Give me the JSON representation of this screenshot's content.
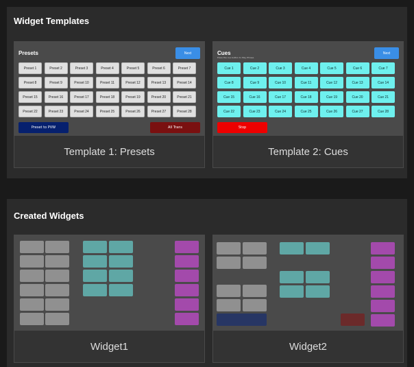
{
  "templates_section": {
    "title": "Widget Templates",
    "cards": [
      {
        "name": "Template 1: Presets",
        "preview": {
          "title": "Presets",
          "next_label": "Next",
          "buttons": [
            "Preset 1",
            "Preset 2",
            "Preset 3",
            "Preset 4",
            "Preset 5",
            "Preset 6",
            "Preset 7",
            "Preset 8",
            "Preset 9",
            "Preset 10",
            "Preset 11",
            "Preset 12",
            "Preset 13",
            "Preset 14",
            "Preset 15",
            "Preset 16",
            "Preset 17",
            "Preset 18",
            "Preset 19",
            "Preset 20",
            "Preset 21",
            "Preset 22",
            "Preset 23",
            "Preset 24",
            "Preset 25",
            "Preset 26",
            "Preset 27",
            "Preset 28"
          ],
          "left_action": "Preset to PVW",
          "right_action": "All Trans"
        }
      },
      {
        "name": "Template 2: Cues",
        "preview": {
          "title": "Cues",
          "subtitle": "Press the cue button to Play Phrase",
          "next_label": "Next",
          "buttons": [
            "Cue 1",
            "Cue 2",
            "Cue 3",
            "Cue 4",
            "Cue 5",
            "Cue 6",
            "Cue 7",
            "Cue 8",
            "Cue 9",
            "Cue 10",
            "Cue 11",
            "Cue 12",
            "Cue 13",
            "Cue 14",
            "Cue 15",
            "Cue 16",
            "Cue 17",
            "Cue 18",
            "Cue 19",
            "Cue 20",
            "Cue 21",
            "Cue 22",
            "Cue 23",
            "Cue 24",
            "Cue 25",
            "Cue 26",
            "Cue 27",
            "Cue 28"
          ],
          "left_action": "Stop"
        }
      }
    ]
  },
  "created_section": {
    "title": "Created Widgets",
    "widgets": [
      {
        "name": "Widget1"
      },
      {
        "name": "Widget2"
      }
    ]
  },
  "colors": {
    "preset_button": "#e0e0e0",
    "cue_button": "#6ef0ee",
    "next_button": "#3a8ee6",
    "preset_to_pvw": "#06206e",
    "all_trans": "#7a1010",
    "stop": "#ee0000",
    "block_gray": "#909090",
    "block_teal": "#5fa7a5",
    "block_purple": "#a34aab"
  }
}
